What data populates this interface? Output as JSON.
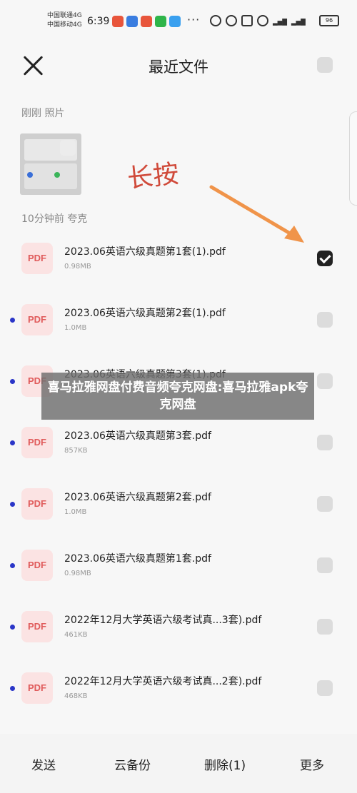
{
  "status_bar": {
    "carrier_1": "中国联通4G",
    "carrier_2": "中国移动4G",
    "time": "6:39",
    "more": "···",
    "battery": "96"
  },
  "header": {
    "title": "最近文件"
  },
  "sections": {
    "just_now": "刚刚 照片",
    "ten_min_ago": "10分钟前 夸克"
  },
  "annotation": {
    "text": "长按",
    "color": "#d04a3a",
    "arrow_color": "#f0944a"
  },
  "files": [
    {
      "name": "2023.06英语六级真题第1套(1).pdf",
      "size": "0.98MB",
      "checked": true,
      "unread": false
    },
    {
      "name": "2023.06英语六级真题第2套(1).pdf",
      "size": "1.0MB",
      "checked": false,
      "unread": true
    },
    {
      "name": "2023.06英语六级真题第3套(1).pdf",
      "size": "",
      "checked": false,
      "unread": true
    },
    {
      "name": "2023.06英语六级真题第3套.pdf",
      "size": "857KB",
      "checked": false,
      "unread": true
    },
    {
      "name": "2023.06英语六级真题第2套.pdf",
      "size": "1.0MB",
      "checked": false,
      "unread": true
    },
    {
      "name": "2023.06英语六级真题第1套.pdf",
      "size": "0.98MB",
      "checked": false,
      "unread": true
    },
    {
      "name": "2022年12月大学英语六级考试真...3套).pdf",
      "size": "461KB",
      "checked": false,
      "unread": true
    },
    {
      "name": "2022年12月大学英语六级考试真...2套).pdf",
      "size": "468KB",
      "checked": false,
      "unread": true
    }
  ],
  "file_icon_label": "PDF",
  "overlay": {
    "text": "喜马拉雅网盘付费音频夸克网盘:喜马拉雅apk夸克网盘"
  },
  "toolbar": {
    "send": "发送",
    "cloud_backup": "云备份",
    "delete": "删除(1)",
    "more": "更多"
  },
  "colors": {
    "accent_dot": "#2a36c8",
    "pdf_icon_bg": "#fbe3e3",
    "pdf_icon_text": "#e05b5b"
  }
}
